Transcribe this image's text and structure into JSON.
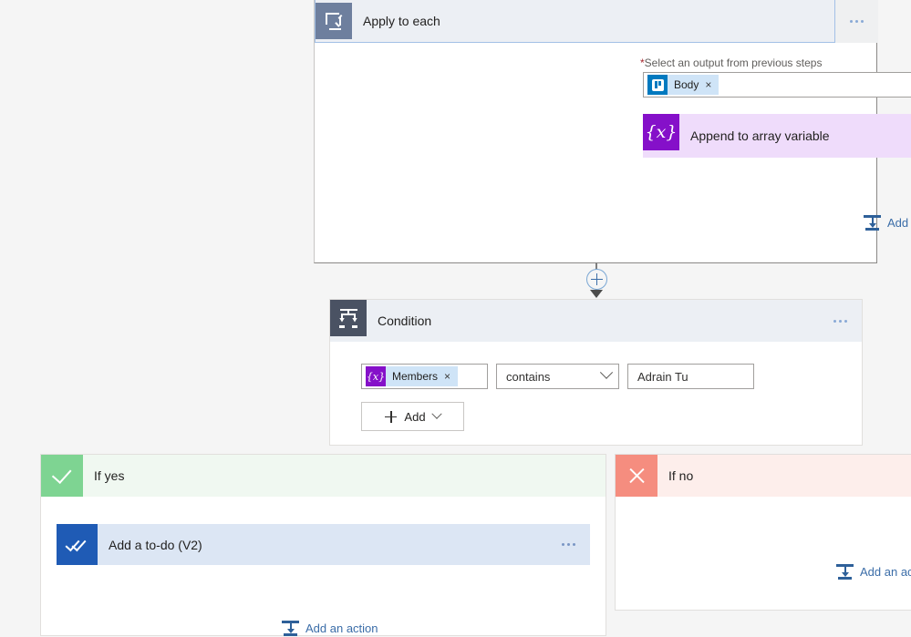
{
  "canvas": {
    "background": "#f5f5f5"
  },
  "apply_to_each": {
    "title": "Apply to each",
    "icon": "loop-icon",
    "menu": "ellipsis-menu",
    "parameter": {
      "required_marker": "*",
      "label": "Select an output from previous steps",
      "token": {
        "text": "Body",
        "icon": "trello-icon",
        "remove": "×",
        "icon_color": "#0079bf"
      }
    },
    "action": {
      "title": "Append to array variable",
      "icon": "variable-icon",
      "icon_glyph": "{x}",
      "icon_color": "#8510c9",
      "card_color": "#efdcfb"
    },
    "add_action_label": "Add an action"
  },
  "connector": {
    "plus_label": "+",
    "accent": "#3b6da8"
  },
  "condition": {
    "title": "Condition",
    "icon": "condition-icon",
    "menu": "ellipsis-menu",
    "row": {
      "operand": {
        "text": "Members",
        "icon": "variable-icon",
        "icon_glyph": "{x}",
        "icon_color": "#8510c9",
        "remove": "×"
      },
      "operator": "contains",
      "value": "Adrain Tu"
    },
    "add_button": {
      "plus": "+",
      "label": "Add"
    }
  },
  "branch_yes": {
    "label": "If yes",
    "icon": "check-icon",
    "icon_color": "#7ed492",
    "header_color": "#f0f8f1",
    "action": {
      "title": "Add a to-do (V2)",
      "icon": "todo-doublecheck-icon",
      "icon_color": "#1f5bb5",
      "card_color": "#dce6f4"
    },
    "add_action_label": "Add an action"
  },
  "branch_no": {
    "label": "If no",
    "icon": "close-icon",
    "icon_color": "#f58d7f",
    "header_color": "#fdeeeb",
    "add_action_label": "Add an action"
  }
}
